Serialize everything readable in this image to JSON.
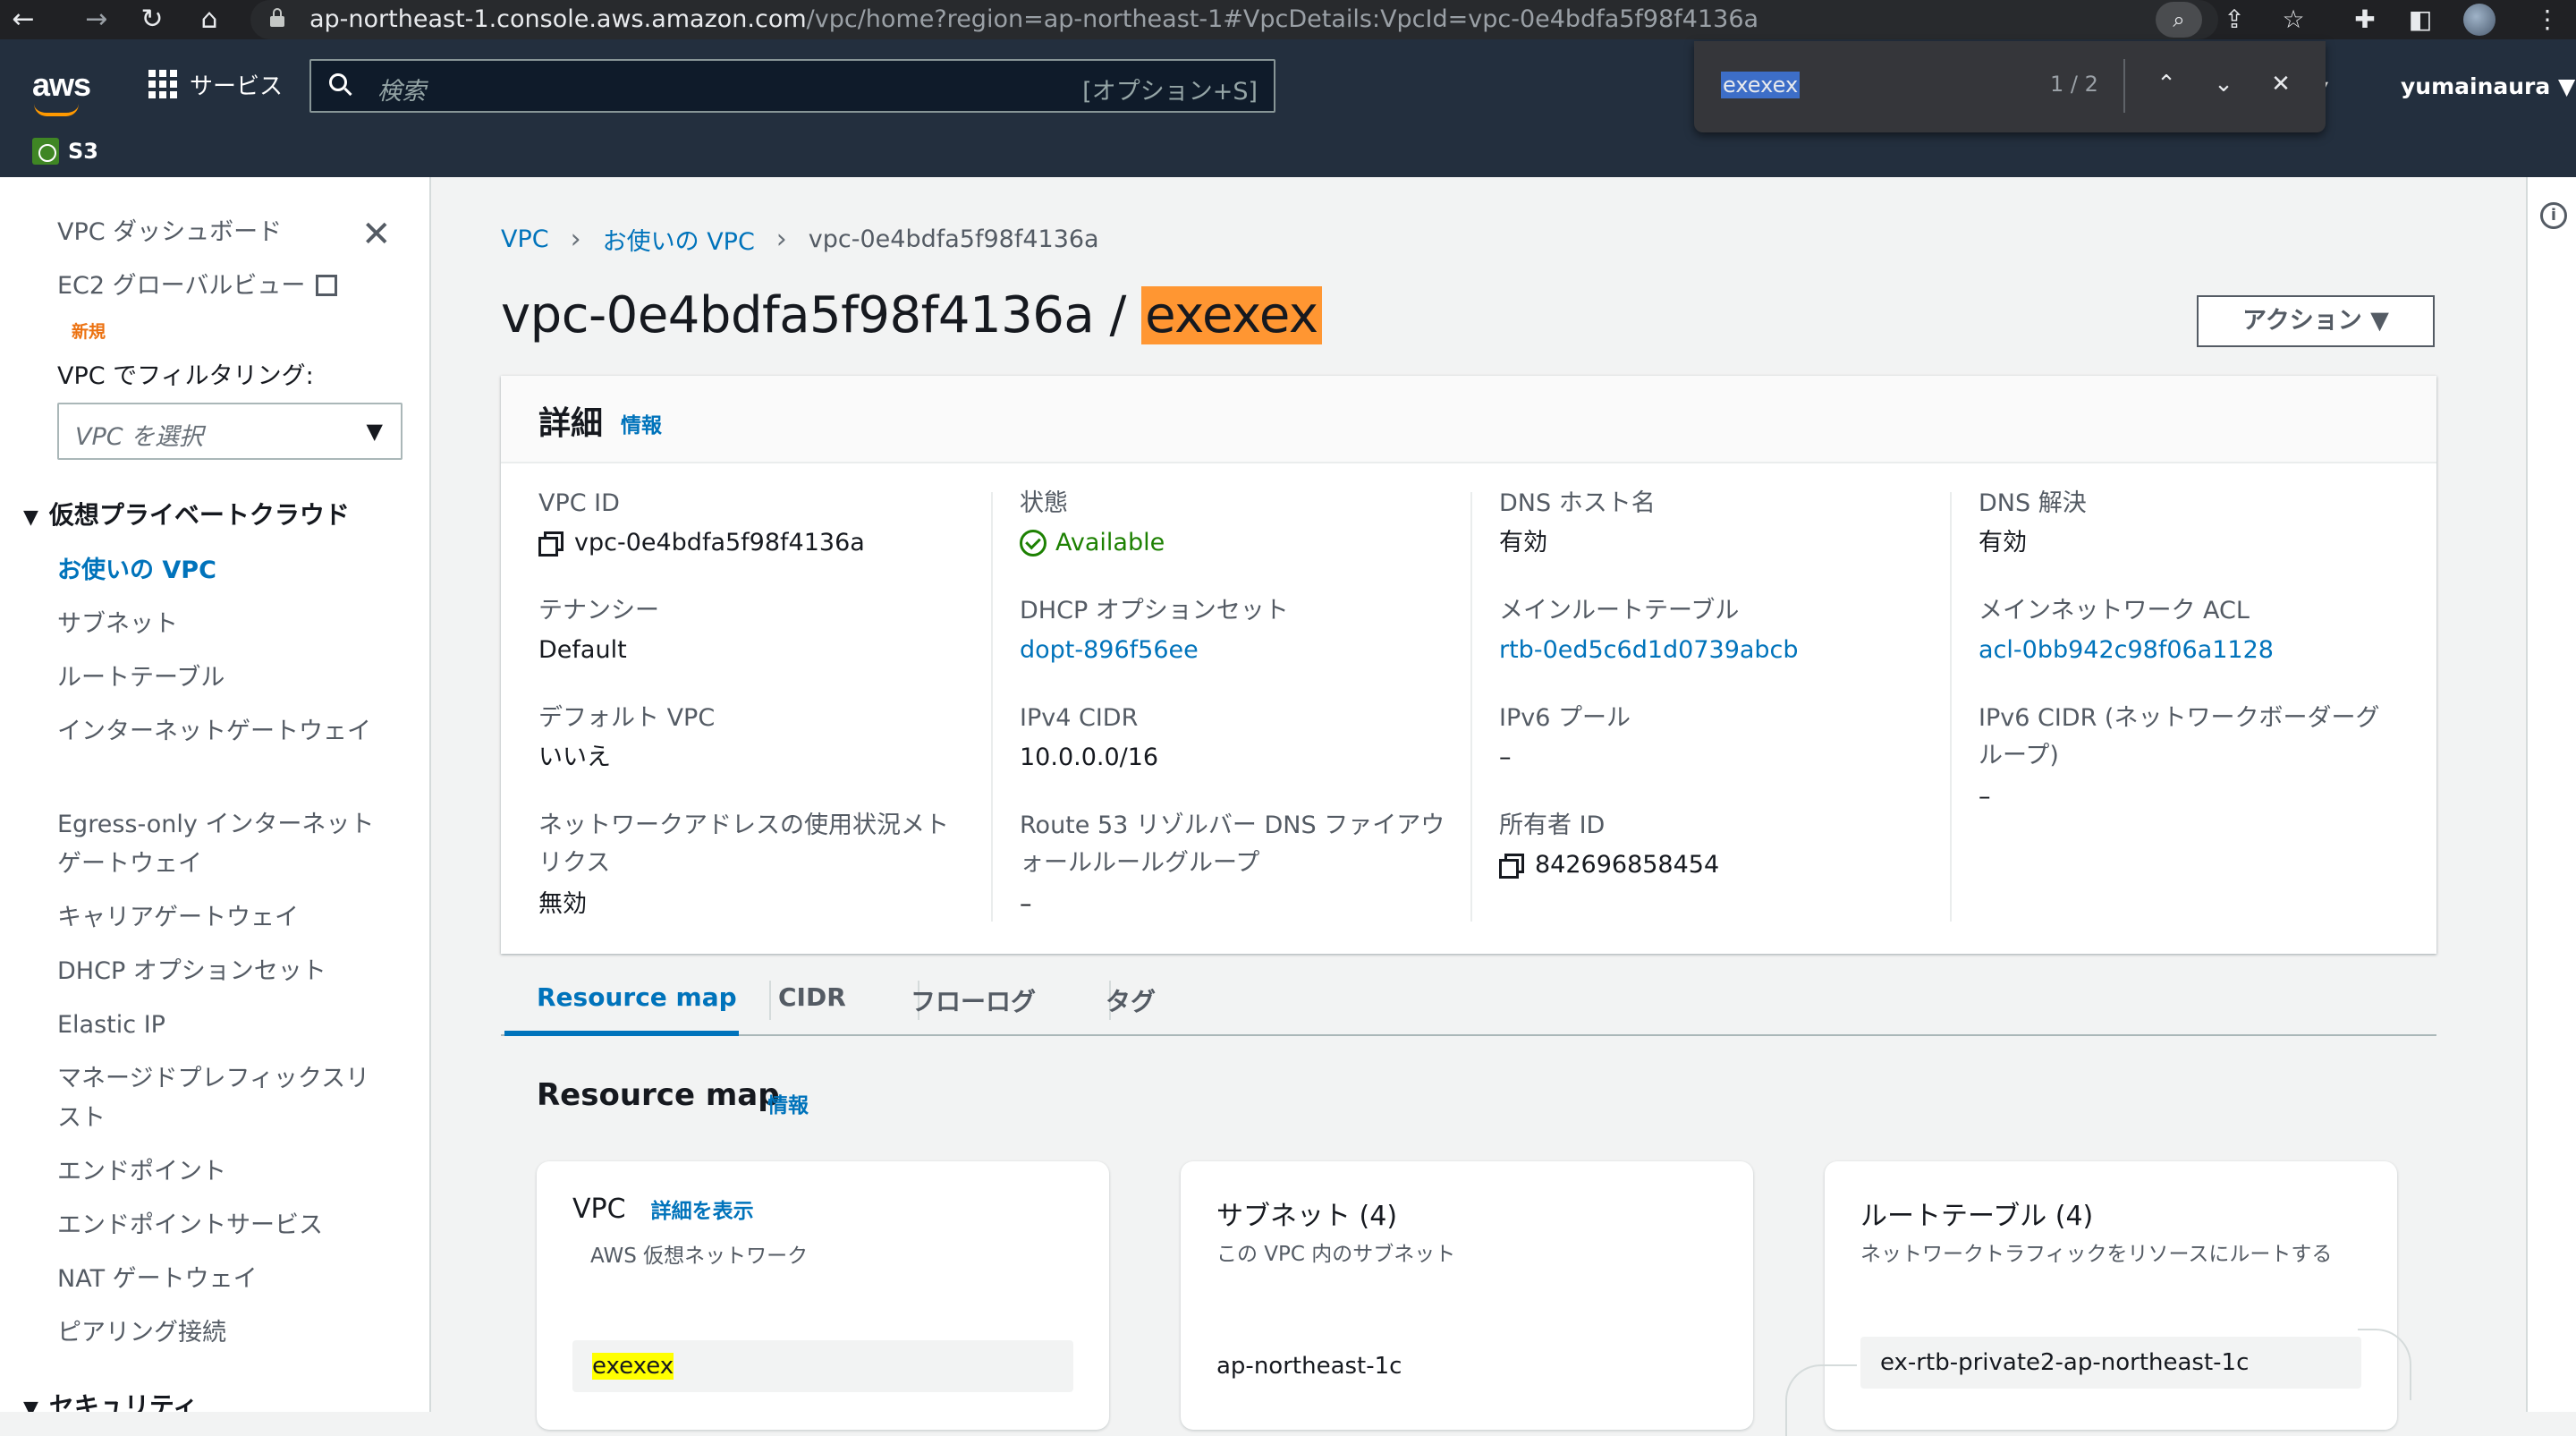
{
  "browser": {
    "url_host": "ap-northeast-1.console.aws.amazon.com",
    "url_path": "/vpc/home?region=ap-northeast-1#VpcDetails:VpcId=vpc-0e4bdfa5f98f4136a"
  },
  "header": {
    "logo": "aws",
    "services_label": "サービス",
    "search_placeholder": "検索",
    "search_shortcut": "[オプション+S]",
    "favorite_s3": "S3",
    "user": "yumainaura ▼"
  },
  "find_bar": {
    "query": "exexex",
    "count": "1 / 2"
  },
  "sidebar": {
    "dashboard": "VPC ダッシュボード",
    "ec2_global_view": "EC2 グローバルビュー",
    "new_badge": "新規",
    "filter_label": "VPC でフィルタリング:",
    "filter_placeholder": "VPC を選択",
    "section_vpc": "仮想プライベートクラウド",
    "items": [
      "お使いの VPC",
      "サブネット",
      "ルートテーブル",
      "インターネットゲートウェイ",
      "Egress-only インターネットゲートウェイ",
      "キャリアゲートウェイ",
      "DHCP オプションセット",
      "Elastic IP",
      "マネージドプレフィックスリスト",
      "エンドポイント",
      "エンドポイントサービス",
      "NAT ゲートウェイ",
      "ピアリング接続"
    ],
    "section_security": "セキュリティ"
  },
  "breadcrumb": {
    "root": "VPC",
    "parent": "お使いの VPC",
    "current": "vpc-0e4bdfa5f98f4136a"
  },
  "page": {
    "title_id": "vpc-0e4bdfa5f98f4136a / ",
    "title_name": "exexex",
    "action_button": "アクション ▼"
  },
  "details": {
    "title": "詳細",
    "info": "情報",
    "vpc_id_label": "VPC ID",
    "vpc_id_value": "vpc-0e4bdfa5f98f4136a",
    "tenancy_label": "テナンシー",
    "tenancy_value": "Default",
    "default_vpc_label": "デフォルト VPC",
    "default_vpc_value": "いいえ",
    "net_usage_label": "ネットワークアドレスの使用状況メトリクス",
    "net_usage_value": "無効",
    "state_label": "状態",
    "state_value": "Available",
    "dhcp_label": "DHCP オプションセット",
    "dhcp_value": "dopt-896f56ee",
    "ipv4_label": "IPv4 CIDR",
    "ipv4_value": "10.0.0.0/16",
    "route53_label": "Route 53 リゾルバー DNS ファイアウォールルールグループ",
    "route53_value": "–",
    "dns_host_label": "DNS ホスト名",
    "dns_host_value": "有効",
    "main_rt_label": "メインルートテーブル",
    "main_rt_value": "rtb-0ed5c6d1d0739abcb",
    "ipv6_pool_label": "IPv6 プール",
    "ipv6_pool_value": "–",
    "owner_label": "所有者 ID",
    "owner_value": "842696858454",
    "dns_res_label": "DNS 解決",
    "dns_res_value": "有効",
    "main_acl_label": "メインネットワーク ACL",
    "main_acl_value": "acl-0bb942c98f06a1128",
    "ipv6_cidr_label": "IPv6 CIDR (ネットワークボーダーグループ)",
    "ipv6_cidr_value": "–"
  },
  "tabs": [
    "Resource map",
    "CIDR",
    "フローログ",
    "タグ"
  ],
  "resource_map": {
    "title": "Resource map",
    "info": "情報",
    "vpc_card": {
      "title": "VPC",
      "link": "詳細を表示",
      "subtitle": "AWS 仮想ネットワーク",
      "item": "exexex"
    },
    "subnet_card": {
      "title": "サブネット (4)",
      "subtitle": "この VPC 内のサブネット",
      "item": "ap-northeast-1c"
    },
    "rt_card": {
      "title": "ルートテーブル (4)",
      "subtitle": "ネットワークトラフィックをリソースにルートする",
      "item": "ex-rtb-private2-ap-northeast-1c"
    }
  },
  "colors": {
    "aws_header": "#232f3e",
    "link": "#0073bb",
    "available": "#1d8102",
    "find_highlight": "#ff9632",
    "find_match": "#ffff00"
  }
}
